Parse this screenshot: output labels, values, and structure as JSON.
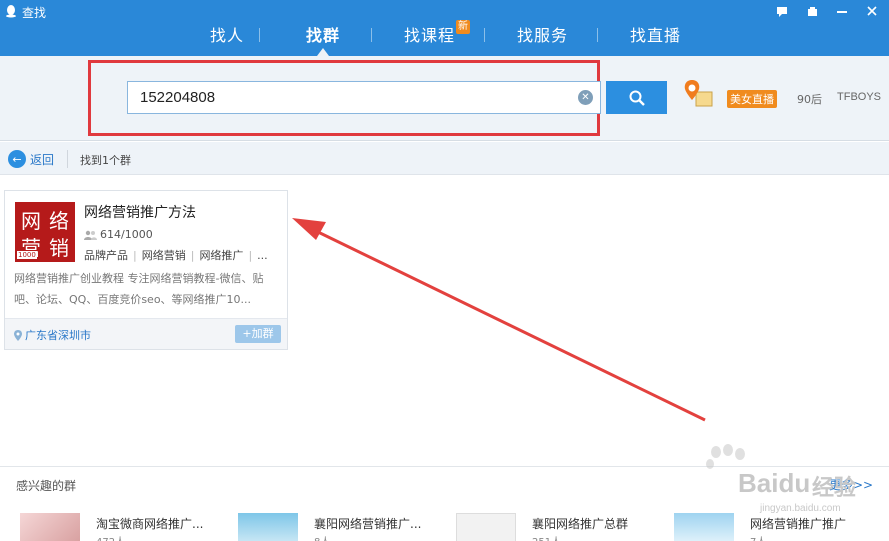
{
  "window": {
    "title": "查找"
  },
  "nav": {
    "tabs": [
      {
        "label": "找人",
        "active": false
      },
      {
        "label": "找群",
        "active": true
      },
      {
        "label": "找课程",
        "active": false,
        "badge": "新"
      },
      {
        "label": "找服务",
        "active": false
      },
      {
        "label": "找直播",
        "active": false
      }
    ]
  },
  "search": {
    "value": "152204808"
  },
  "hot": {
    "tag": "美女直播",
    "link1": "90后",
    "link2": "TFBOYS"
  },
  "results": {
    "back_label": "返回",
    "count_text": "找到1个群"
  },
  "group": {
    "name": "网络营销推广方法",
    "avatar_chars": [
      "网",
      "络",
      "营",
      "销"
    ],
    "avatar_small": "1000",
    "members": "614/1000",
    "tags": [
      "品牌产品",
      "网络营销",
      "网络推广",
      "..."
    ],
    "description": "网络营销推广创业教程 专注网络营销教程-微信、贴吧、论坛、QQ、百度竞价seo、等网络推广10...",
    "location": "广东省深圳市",
    "join_label": "+加群"
  },
  "recommended": {
    "title": "感兴趣的群",
    "more": "更多>>",
    "items": [
      {
        "name": "淘宝微商网络推广...",
        "count": "472人"
      },
      {
        "name": "襄阳网络营销推广...",
        "count": "8人"
      },
      {
        "name": "襄阳网络推广总群",
        "count": "251人"
      },
      {
        "name": "网络营销推广推广",
        "count": "7人"
      }
    ]
  },
  "watermark": {
    "brand": "Baidu",
    "suffix": "经验",
    "url": "jingyan.baidu.com"
  },
  "colors": {
    "topbar": "#2a88d8",
    "accent": "#2c8fe0",
    "highlight": "#e0393e",
    "badge": "#f08b1e"
  }
}
